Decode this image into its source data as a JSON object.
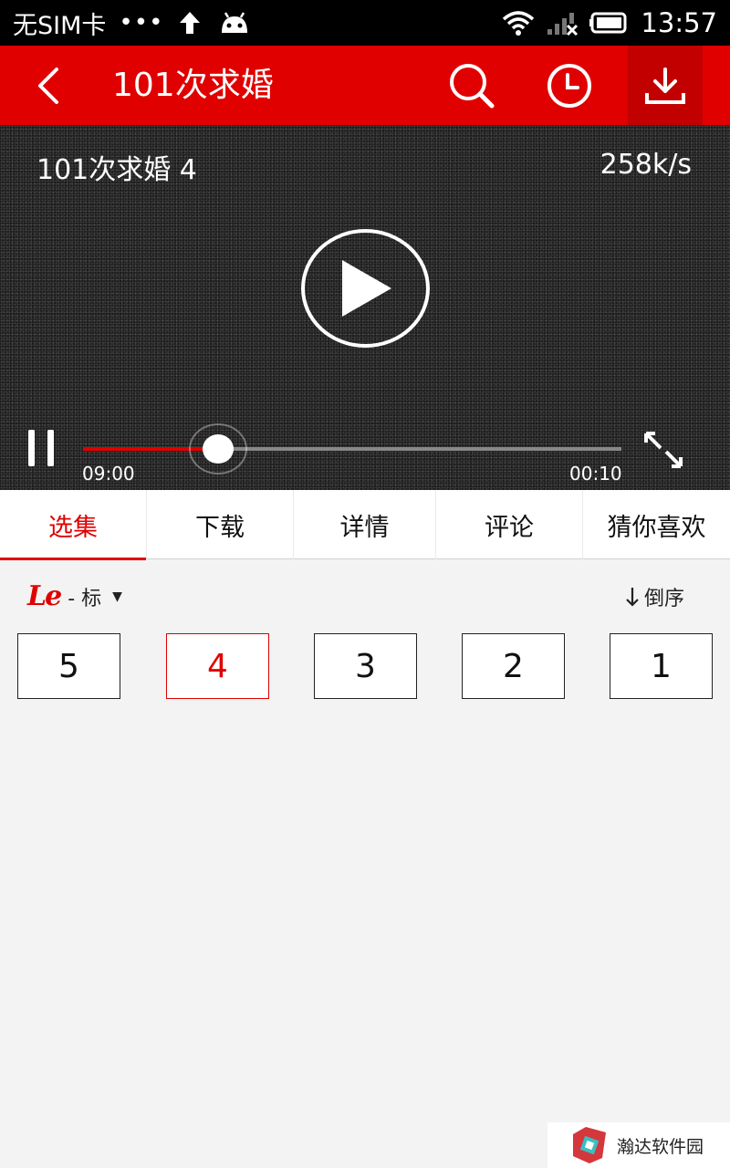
{
  "status_bar": {
    "carrier": "无SIM卡",
    "dots": "•••",
    "time": "13:57"
  },
  "app_bar": {
    "title": "101次求婚"
  },
  "player": {
    "video_title": "101次求婚 4",
    "speed": "258k/s",
    "time_current": "09:00",
    "time_total": "00:10",
    "progress": 0.25
  },
  "tabs": [
    {
      "label": "选集",
      "active": true
    },
    {
      "label": "下载",
      "active": false
    },
    {
      "label": "详情",
      "active": false
    },
    {
      "label": "评论",
      "active": false
    },
    {
      "label": "猜你喜欢",
      "active": false
    }
  ],
  "episodes_section": {
    "source_logo": "Le",
    "quality": "- 标",
    "sort_label": "倒序",
    "episodes": [
      "5",
      "4",
      "3",
      "2",
      "1"
    ],
    "selected_episode": "4"
  },
  "watermark": {
    "text": "瀚达软件园"
  },
  "colors": {
    "accent": "#e00000",
    "download_bg": "#c20000",
    "background": "#f3f3f3"
  }
}
